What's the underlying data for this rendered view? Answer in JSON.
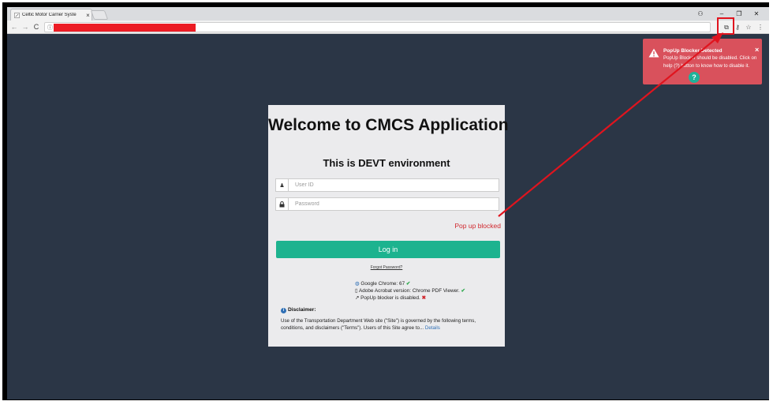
{
  "browser": {
    "tab_title": "Celtic Motor Carrier Syste",
    "tab_close": "×",
    "window_controls": {
      "user": "⚇",
      "minimize": "–",
      "restore": "❐",
      "close": "✕"
    },
    "nav": {
      "back": "←",
      "forward": "→",
      "reload": "C"
    },
    "omnibox_info": "ⓘ",
    "url": "",
    "toolbar_icons": {
      "popup_blocked": "⧉",
      "key": "⚷",
      "star": "☆",
      "menu": "⋮"
    }
  },
  "notification": {
    "title": "PopUp Blocker Detected",
    "message": "PopUp Blocker should be disabled. Click on help (?) button to know how to disable it.",
    "close": "×",
    "help": "?",
    "color": "#d9515c"
  },
  "login": {
    "heading": "Welcome to CMCS Application",
    "environment": "This is DEVT environment",
    "userid_placeholder": "User ID",
    "userid_value": "",
    "password_placeholder": "Password",
    "password_value": "",
    "user_icon": "♟",
    "lock_icon": "🔒",
    "popup_status": "Pop up blocked",
    "login_button": "Log in",
    "forgot_password": "Forgot Password?",
    "accent": "#1db38f"
  },
  "requirements": [
    {
      "icon": "globe-icon",
      "glyph": "◍",
      "text": "Google Chrome: 67",
      "status": "✔",
      "ok": true
    },
    {
      "icon": "document-icon",
      "glyph": "▯",
      "text": "Adobe Acrobat version: Chrome PDF Viewer.",
      "status": "✔",
      "ok": true
    },
    {
      "icon": "external-link-icon",
      "glyph": "↗",
      "text": "PopUp blocker is disabled.",
      "status": "✖",
      "ok": false
    }
  ],
  "disclaimer": {
    "title": "Disclaimer:",
    "text": "Use of the Transportation Department Web site (\"Site\") is governed by the following terms, conditions, and disclaimers (\"Terms\"). Users of this Site agree to...",
    "details_link": "Details"
  }
}
